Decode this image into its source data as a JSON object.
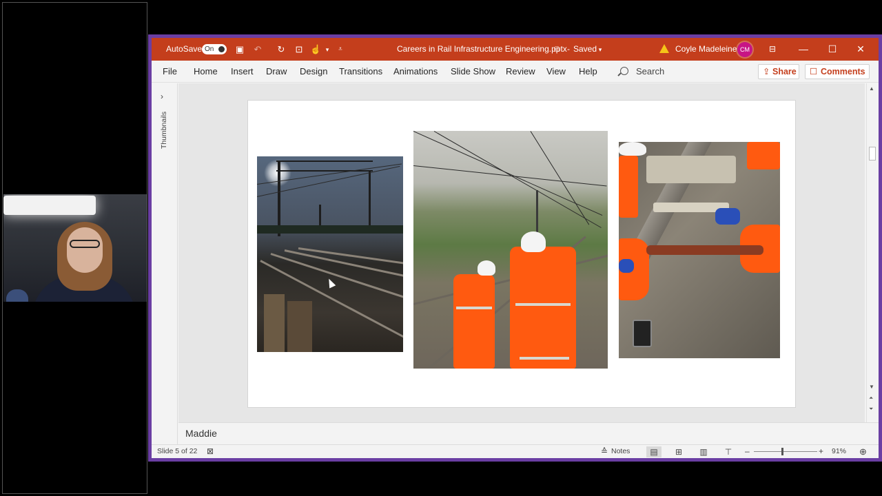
{
  "meeting": {
    "participant_name": "Maddie"
  },
  "titlebar": {
    "autosave_label": "AutoSave",
    "autosave_state": "On",
    "document_title": "Careers in Rail Infrastructure Engineering.pptx",
    "save_status": "Saved",
    "user_name": "Coyle Madeleine",
    "user_initials": "CM",
    "accent_color": "#c43e1c"
  },
  "menu": {
    "items": [
      "File",
      "Home",
      "Insert",
      "Draw",
      "Design",
      "Transitions",
      "Animations",
      "Slide Show",
      "Review",
      "View",
      "Help"
    ],
    "search_label": "Search",
    "share_label": "Share",
    "comments_label": "Comments"
  },
  "thumbnails_pane": {
    "label": "Thumbnails"
  },
  "slide": {
    "images": [
      {
        "description_icon": "railway-gantry-photo"
      },
      {
        "description_icon": "track-workers-photo"
      },
      {
        "description_icon": "rail-maintenance-photo"
      }
    ]
  },
  "notes": {
    "text": "Maddie"
  },
  "statusbar": {
    "slide_indicator": "Slide 5 of 22",
    "notes_label": "Notes",
    "zoom_minus": "–",
    "zoom_plus": "+",
    "zoom_level": "91%"
  }
}
